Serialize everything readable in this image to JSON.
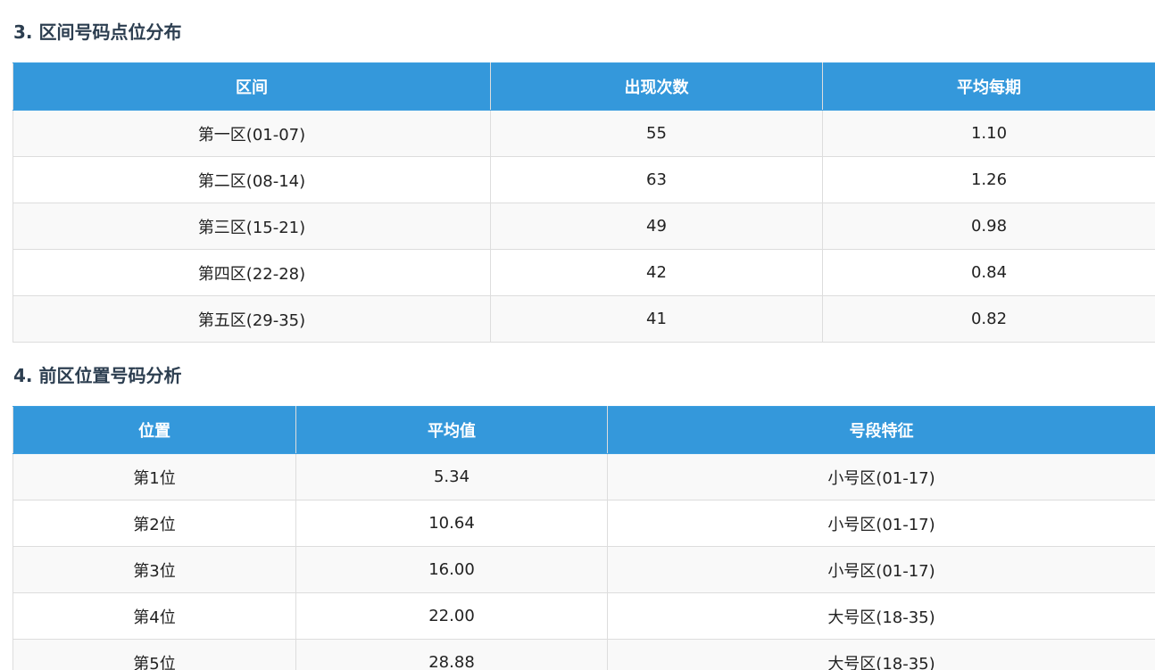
{
  "section1": {
    "title": "3. 区间号码点位分布",
    "headers": [
      "区间",
      "出现次数",
      "平均每期"
    ],
    "rows": [
      [
        "第一区(01-07)",
        "55",
        "1.10"
      ],
      [
        "第二区(08-14)",
        "63",
        "1.26"
      ],
      [
        "第三区(15-21)",
        "49",
        "0.98"
      ],
      [
        "第四区(22-28)",
        "42",
        "0.84"
      ],
      [
        "第五区(29-35)",
        "41",
        "0.82"
      ]
    ]
  },
  "section2": {
    "title": "4. 前区位置号码分析",
    "headers": [
      "位置",
      "平均值",
      "号段特征"
    ],
    "rows": [
      [
        "第1位",
        "5.34",
        "小号区(01-17)"
      ],
      [
        "第2位",
        "10.64",
        "小号区(01-17)"
      ],
      [
        "第3位",
        "16.00",
        "小号区(01-17)"
      ],
      [
        "第4位",
        "22.00",
        "大号区(18-35)"
      ],
      [
        "第5位",
        "28.88",
        "大号区(18-35)"
      ]
    ]
  },
  "colors": {
    "header_bg": "#3498db",
    "header_text": "#ffffff",
    "title_text": "#2c3e50",
    "row_alt": "#f9f9f9",
    "border": "#dddddd"
  }
}
